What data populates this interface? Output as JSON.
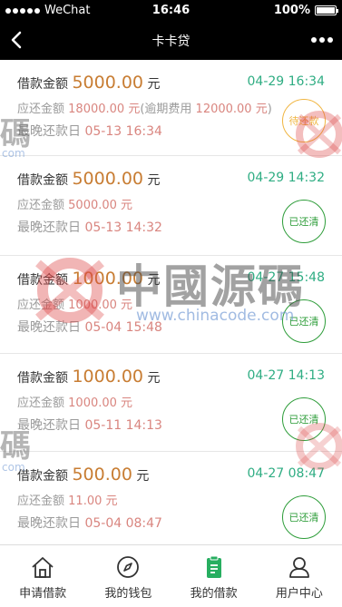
{
  "status_bar": {
    "carrier": "WeChat",
    "time": "16:46",
    "battery": "100%"
  },
  "nav": {
    "title": "卡卡贷"
  },
  "loans": [
    {
      "amount_label": "借款金额",
      "amount": "5000.00",
      "unit": "元",
      "date": "04-29 16:34",
      "due_label": "应还金额",
      "due_amount": "18000.00 元",
      "overdue_open": "(逾期费用 ",
      "overdue_fee": "12000.00 元",
      "overdue_close": ")",
      "deadline_label": "最晚还款日",
      "deadline": "05-13 16:34",
      "status": "待还款",
      "status_type": "pending"
    },
    {
      "amount_label": "借款金额",
      "amount": "5000.00",
      "unit": "元",
      "date": "04-29 14:32",
      "due_label": "应还金额",
      "due_amount": "5000.00 元",
      "deadline_label": "最晚还款日",
      "deadline": "05-13 14:32",
      "status": "已还清",
      "status_type": "cleared"
    },
    {
      "amount_label": "借款金额",
      "amount": "1000.00",
      "unit": "元",
      "date": "04-27 15:48",
      "due_label": "应还金额",
      "due_amount": "1000.00 元",
      "deadline_label": "最晚还款日",
      "deadline": "05-04 15:48",
      "status": "已还清",
      "status_type": "cleared"
    },
    {
      "amount_label": "借款金额",
      "amount": "1000.00",
      "unit": "元",
      "date": "04-27 14:13",
      "due_label": "应还金额",
      "due_amount": "1000.00 元",
      "deadline_label": "最晚还款日",
      "deadline": "05-11 14:13",
      "status": "已还清",
      "status_type": "cleared"
    },
    {
      "amount_label": "借款金额",
      "amount": "500.00",
      "unit": "元",
      "date": "04-27 08:47",
      "due_label": "应还金额",
      "due_amount": "11.00 元",
      "deadline_label": "最晚还款日",
      "deadline": "05-04 08:47",
      "status": "已还清",
      "status_type": "cleared"
    }
  ],
  "tabbar": [
    {
      "label": "申请借款",
      "icon": "home-icon"
    },
    {
      "label": "我的钱包",
      "icon": "compass-icon"
    },
    {
      "label": "我的借款",
      "icon": "clipboard-icon"
    },
    {
      "label": "用户中心",
      "icon": "user-icon"
    }
  ],
  "watermark": {
    "text": "中國源碼",
    "url": "www.chinacode.com",
    "char": "碼",
    "com": "com"
  },
  "colors": {
    "amount": "#c87d33",
    "date": "#2fad83",
    "red": "#d9857f",
    "pending": "#f0b541",
    "cleared": "#2e9d3a",
    "tab_active": "#27ae60"
  }
}
